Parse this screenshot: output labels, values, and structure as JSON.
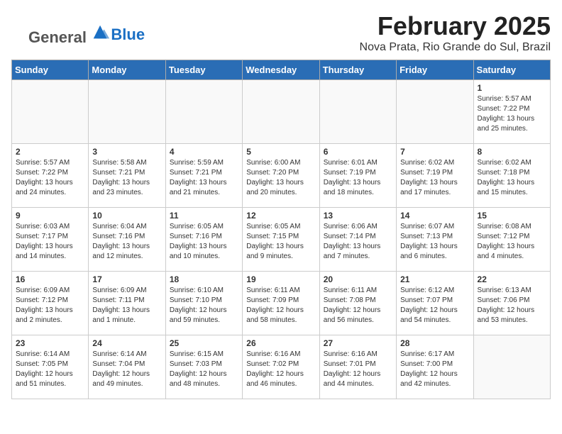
{
  "logo": {
    "general": "General",
    "blue": "Blue"
  },
  "header": {
    "title": "February 2025",
    "subtitle": "Nova Prata, Rio Grande do Sul, Brazil"
  },
  "weekdays": [
    "Sunday",
    "Monday",
    "Tuesday",
    "Wednesday",
    "Thursday",
    "Friday",
    "Saturday"
  ],
  "weeks": [
    [
      {
        "day": "",
        "info": ""
      },
      {
        "day": "",
        "info": ""
      },
      {
        "day": "",
        "info": ""
      },
      {
        "day": "",
        "info": ""
      },
      {
        "day": "",
        "info": ""
      },
      {
        "day": "",
        "info": ""
      },
      {
        "day": "1",
        "info": "Sunrise: 5:57 AM\nSunset: 7:22 PM\nDaylight: 13 hours and 25 minutes."
      }
    ],
    [
      {
        "day": "2",
        "info": "Sunrise: 5:57 AM\nSunset: 7:22 PM\nDaylight: 13 hours and 24 minutes."
      },
      {
        "day": "3",
        "info": "Sunrise: 5:58 AM\nSunset: 7:21 PM\nDaylight: 13 hours and 23 minutes."
      },
      {
        "day": "4",
        "info": "Sunrise: 5:59 AM\nSunset: 7:21 PM\nDaylight: 13 hours and 21 minutes."
      },
      {
        "day": "5",
        "info": "Sunrise: 6:00 AM\nSunset: 7:20 PM\nDaylight: 13 hours and 20 minutes."
      },
      {
        "day": "6",
        "info": "Sunrise: 6:01 AM\nSunset: 7:19 PM\nDaylight: 13 hours and 18 minutes."
      },
      {
        "day": "7",
        "info": "Sunrise: 6:02 AM\nSunset: 7:19 PM\nDaylight: 13 hours and 17 minutes."
      },
      {
        "day": "8",
        "info": "Sunrise: 6:02 AM\nSunset: 7:18 PM\nDaylight: 13 hours and 15 minutes."
      }
    ],
    [
      {
        "day": "9",
        "info": "Sunrise: 6:03 AM\nSunset: 7:17 PM\nDaylight: 13 hours and 14 minutes."
      },
      {
        "day": "10",
        "info": "Sunrise: 6:04 AM\nSunset: 7:16 PM\nDaylight: 13 hours and 12 minutes."
      },
      {
        "day": "11",
        "info": "Sunrise: 6:05 AM\nSunset: 7:16 PM\nDaylight: 13 hours and 10 minutes."
      },
      {
        "day": "12",
        "info": "Sunrise: 6:05 AM\nSunset: 7:15 PM\nDaylight: 13 hours and 9 minutes."
      },
      {
        "day": "13",
        "info": "Sunrise: 6:06 AM\nSunset: 7:14 PM\nDaylight: 13 hours and 7 minutes."
      },
      {
        "day": "14",
        "info": "Sunrise: 6:07 AM\nSunset: 7:13 PM\nDaylight: 13 hours and 6 minutes."
      },
      {
        "day": "15",
        "info": "Sunrise: 6:08 AM\nSunset: 7:12 PM\nDaylight: 13 hours and 4 minutes."
      }
    ],
    [
      {
        "day": "16",
        "info": "Sunrise: 6:09 AM\nSunset: 7:12 PM\nDaylight: 13 hours and 2 minutes."
      },
      {
        "day": "17",
        "info": "Sunrise: 6:09 AM\nSunset: 7:11 PM\nDaylight: 13 hours and 1 minute."
      },
      {
        "day": "18",
        "info": "Sunrise: 6:10 AM\nSunset: 7:10 PM\nDaylight: 12 hours and 59 minutes."
      },
      {
        "day": "19",
        "info": "Sunrise: 6:11 AM\nSunset: 7:09 PM\nDaylight: 12 hours and 58 minutes."
      },
      {
        "day": "20",
        "info": "Sunrise: 6:11 AM\nSunset: 7:08 PM\nDaylight: 12 hours and 56 minutes."
      },
      {
        "day": "21",
        "info": "Sunrise: 6:12 AM\nSunset: 7:07 PM\nDaylight: 12 hours and 54 minutes."
      },
      {
        "day": "22",
        "info": "Sunrise: 6:13 AM\nSunset: 7:06 PM\nDaylight: 12 hours and 53 minutes."
      }
    ],
    [
      {
        "day": "23",
        "info": "Sunrise: 6:14 AM\nSunset: 7:05 PM\nDaylight: 12 hours and 51 minutes."
      },
      {
        "day": "24",
        "info": "Sunrise: 6:14 AM\nSunset: 7:04 PM\nDaylight: 12 hours and 49 minutes."
      },
      {
        "day": "25",
        "info": "Sunrise: 6:15 AM\nSunset: 7:03 PM\nDaylight: 12 hours and 48 minutes."
      },
      {
        "day": "26",
        "info": "Sunrise: 6:16 AM\nSunset: 7:02 PM\nDaylight: 12 hours and 46 minutes."
      },
      {
        "day": "27",
        "info": "Sunrise: 6:16 AM\nSunset: 7:01 PM\nDaylight: 12 hours and 44 minutes."
      },
      {
        "day": "28",
        "info": "Sunrise: 6:17 AM\nSunset: 7:00 PM\nDaylight: 12 hours and 42 minutes."
      },
      {
        "day": "",
        "info": ""
      }
    ]
  ]
}
